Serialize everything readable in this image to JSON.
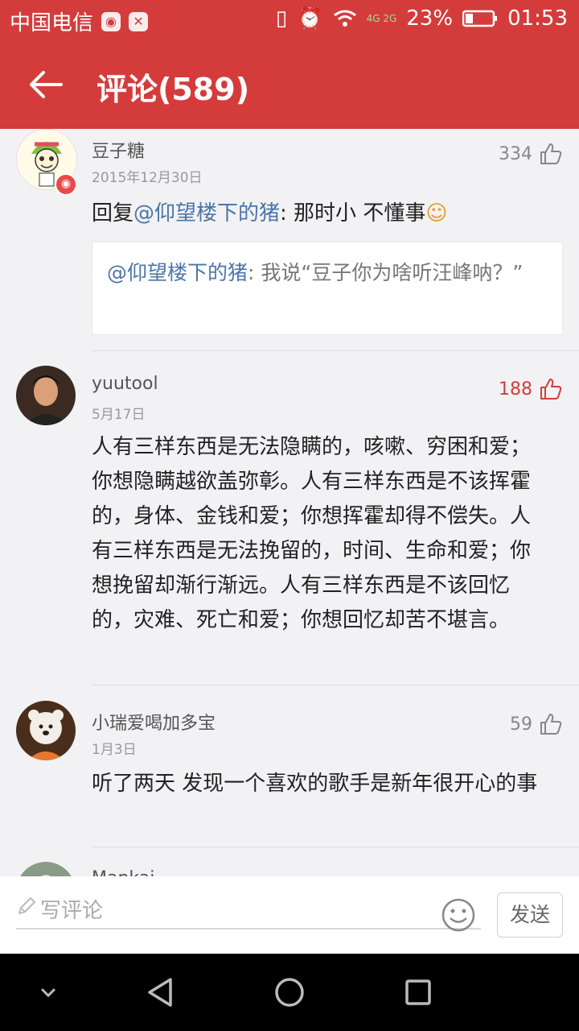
{
  "status_bar": {
    "carrier": "中国电信",
    "battery_percent": "23%",
    "time": "01:53",
    "network": "4G 2G"
  },
  "app_bar": {
    "title": "评论(589)"
  },
  "comments": [
    {
      "username": "豆子糖",
      "date": "2015年12月30日",
      "likes": "334",
      "reply_prefix": "回复",
      "mention": "@仰望楼下的猪",
      "text": ": 那时小 不懂事",
      "emoji": "☺",
      "quote_mention": "@仰望楼下的猪",
      "quote_text": ": 我说“豆子你为啥听汪峰呐？”"
    },
    {
      "username": "yuutool",
      "date": "5月17日",
      "likes": "188",
      "text": "人有三样东西是无法隐瞒的，咳嗽、穷困和爱；你想隐瞒越欲盖弥彰。人有三样东西是不该挥霍的，身体、金钱和爱；你想挥霍却得不偿失。人有三样东西是无法挽留的，时间、生命和爱；你想挽留却渐行渐远。人有三样东西是不该回忆的，灾难、死亡和爱；你想回忆却苦不堪言。"
    },
    {
      "username": "小瑞爱喝加多宝",
      "date": "1月3日",
      "likes": "59",
      "text": "听了两天 发现一个喜欢的歌手是新年很开心的事"
    },
    {
      "username": "Mankai"
    }
  ],
  "input_bar": {
    "placeholder": "写评论",
    "send_label": "发送"
  },
  "colors": {
    "brand_red": "#d43c3c",
    "mention_blue": "#4a76a8"
  },
  "icons": [
    "back-arrow-icon",
    "thumbs-up-icon",
    "pencil-icon",
    "smiley-icon",
    "nav-back-icon",
    "nav-home-icon",
    "nav-recents-icon"
  ]
}
